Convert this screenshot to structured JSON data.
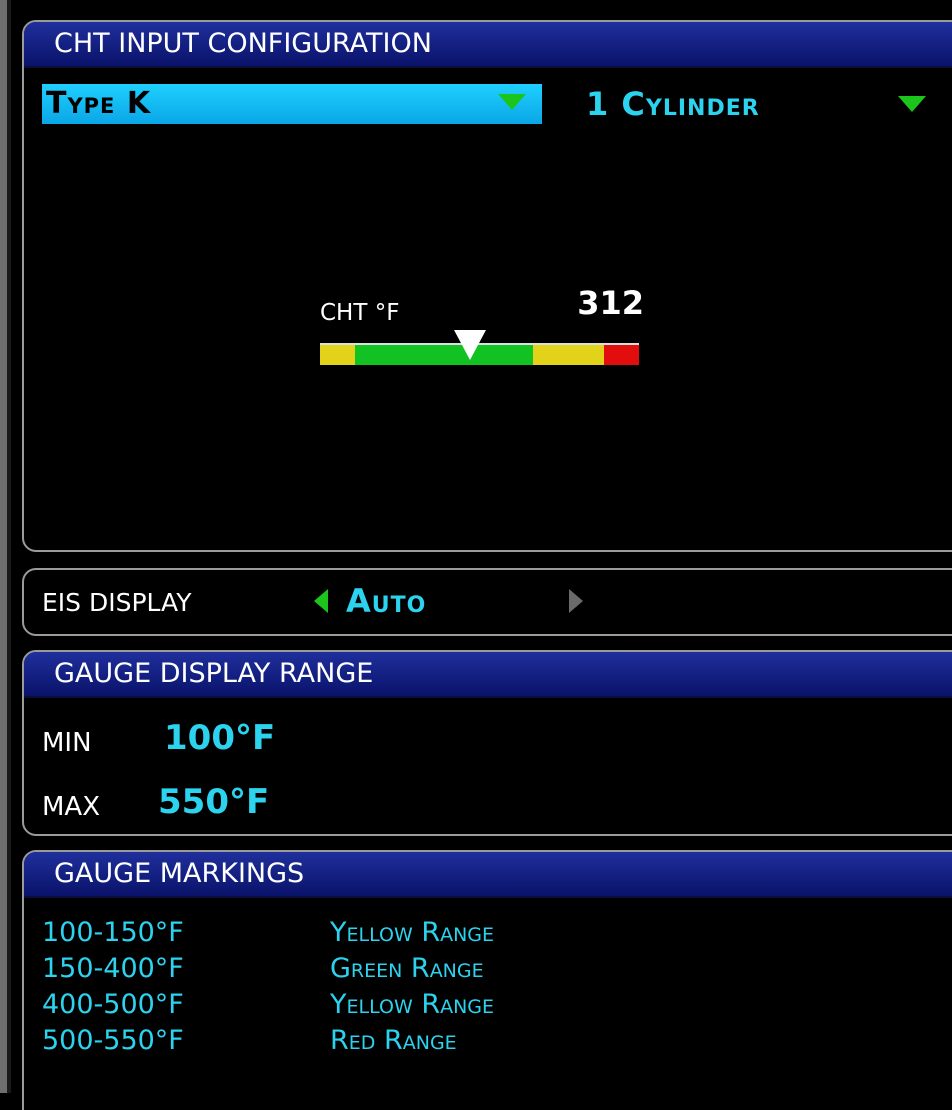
{
  "config_panel": {
    "title": "CHT INPUT CONFIGURATION",
    "sensor_type": "Type K",
    "cylinders": "1 Cylinder"
  },
  "gauge": {
    "label": "CHT °F",
    "value": "312",
    "value_numeric": 312,
    "bands": [
      {
        "color": "#e3d21a",
        "from": 100,
        "to": 150
      },
      {
        "color": "#12c222",
        "from": 150,
        "to": 400
      },
      {
        "color": "#e3d21a",
        "from": 400,
        "to": 500
      },
      {
        "color": "#e20e0e",
        "from": 500,
        "to": 550
      }
    ]
  },
  "eis": {
    "label": "EIS DISPLAY",
    "value": "Auto"
  },
  "range_panel": {
    "title": "GAUGE DISPLAY RANGE",
    "min_label": "MIN",
    "min_value": "100°F",
    "max_label": "MAX",
    "max_value": "550°F"
  },
  "markings_panel": {
    "title": "GAUGE MARKINGS",
    "rows": [
      {
        "range": "100-150°F",
        "color": "Yellow Range"
      },
      {
        "range": "150-400°F",
        "color": "Green Range"
      },
      {
        "range": "400-500°F",
        "color": "Yellow Range"
      },
      {
        "range": "500-550°F",
        "color": "Red Range"
      }
    ]
  },
  "colors": {
    "header_blue": "#1a2a96",
    "selection_cyan": "#1fc6f7",
    "value_cyan": "#2bd3ef",
    "arrow_green": "#1cc51c"
  }
}
